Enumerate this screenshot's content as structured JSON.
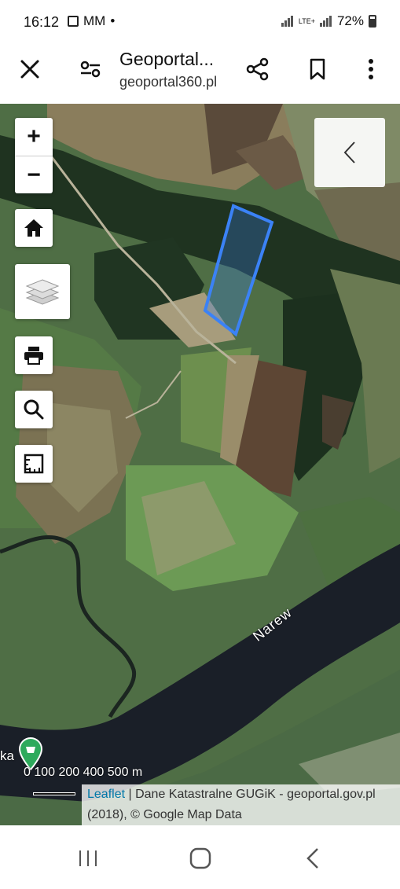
{
  "status_bar": {
    "time": "16:12",
    "notification_glyphs": "MM",
    "network": "LTE+",
    "battery": "72%"
  },
  "toolbar": {
    "title": "Geoportal...",
    "url": "geoportal360.pl",
    "icons": [
      "close-icon",
      "page-settings-icon",
      "share-icon",
      "bookmark-icon",
      "more-icon"
    ]
  },
  "map": {
    "zoom_in": "+",
    "zoom_out": "−",
    "controls": [
      "home-icon",
      "layers-icon",
      "print-icon",
      "search-icon",
      "measure-icon"
    ],
    "river_label": "Narew",
    "place_label_fragment": "ka",
    "scale_labels": "0    100   200         400   500 m",
    "attribution_link": "Leaflet",
    "attribution_text": " | Dane Katastralne GUGiK - geoportal.gov.pl (2018), © Google Map Data",
    "parcel_color": "#3b82f6"
  },
  "nav_bar": {
    "icons": [
      "recent-apps-icon",
      "home-button-icon",
      "back-icon"
    ]
  }
}
